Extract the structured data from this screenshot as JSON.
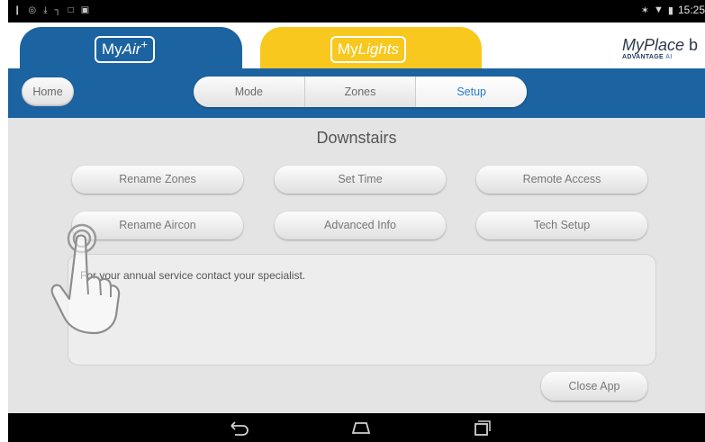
{
  "status_bar": {
    "left_icons": [
      "notification-icon",
      "alarm-icon",
      "download-icon",
      "signal-icon",
      "cast-icon",
      "image-icon"
    ],
    "right_icons": [
      "bluetooth-icon",
      "wifi-icon",
      "battery-icon"
    ],
    "time": "15:25"
  },
  "header": {
    "tabs": [
      {
        "logo_my": "My",
        "logo_name": "Air",
        "logo_suffix": "+",
        "color": "#1c63a2"
      },
      {
        "logo_my": "My",
        "logo_name": "Lights",
        "logo_suffix": "",
        "color": "#f8c81e"
      }
    ],
    "brand": {
      "main": "MyPlace",
      "suffix": "b",
      "sub_main": "ADVANTAGE",
      "sub_rest": "AI"
    }
  },
  "nav": {
    "home_label": "Home",
    "segments": [
      "Mode",
      "Zones",
      "Setup"
    ],
    "active_segment": "Setup"
  },
  "content": {
    "title": "Downstairs",
    "buttons": [
      {
        "label": "Rename Zones"
      },
      {
        "label": "Set Time"
      },
      {
        "label": "Remote Access"
      },
      {
        "label": "Rename Aircon"
      },
      {
        "label": "Advanced Info"
      },
      {
        "label": "Tech Setup"
      }
    ],
    "service_note": "For your annual service contact your specialist.",
    "close_label": "Close App"
  },
  "android_nav": {
    "icons": [
      "back-icon",
      "home-icon",
      "recents-icon"
    ]
  },
  "colors": {
    "brand_blue": "#1c63a2",
    "brand_yellow": "#f8c81e",
    "active_tab": "#2a7cc7",
    "background": "#e4e4e4"
  }
}
